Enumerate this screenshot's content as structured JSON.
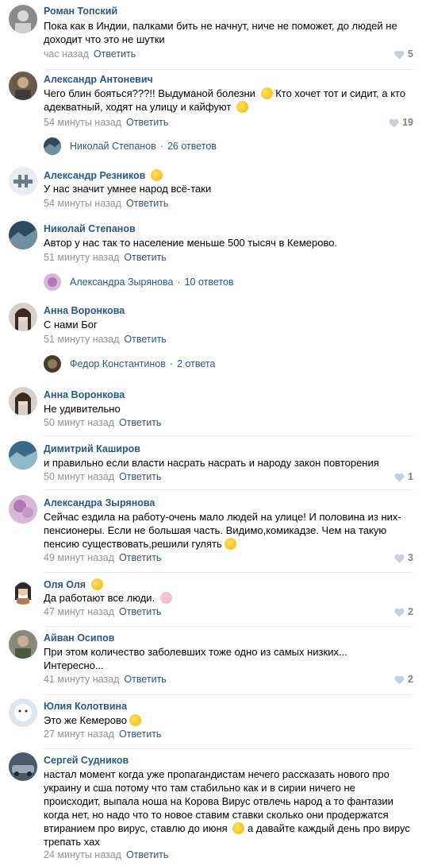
{
  "comments": [
    {
      "author": "Роман Топский",
      "text": "Пока как в Индии, палками бить не начнут, ниче не поможет, до людей не доходит что это не шутки",
      "time": "час назад",
      "reply": "Ответить",
      "likes": "5"
    },
    {
      "author": "Александр Антоневич",
      "text": "Чего блин бояться???!! Выдуманой болезни",
      "text2": "Кто хочет тот и сидит, а кто адекватный, ходят на улицу и кайфуют",
      "time": "54 минуты назад",
      "reply": "Ответить",
      "likes": "19"
    },
    {
      "author": "Александр Резников",
      "text": "У нас значит умнее народ всё-таки",
      "time": "54 минуты назад",
      "reply": "Ответить",
      "likes": ""
    },
    {
      "author": "Николай Степанов",
      "text": "Автор у нас так то население меньше 500 тысяч в Кемерово.",
      "time": "51 минуту назад",
      "reply": "Ответить",
      "likes": ""
    },
    {
      "author": "Анна Воронкова",
      "text": "С нами Бог",
      "time": "51 минуту назад",
      "reply": "Ответить",
      "likes": ""
    },
    {
      "author": "Анна Воронкова",
      "text": "Не удивительно",
      "time": "50 минут назад",
      "reply": "Ответить",
      "likes": ""
    },
    {
      "author": "Димитрий Каширов",
      "text": "и правильно если власти насрать насрать и народу закон повторения",
      "time": "50 минут назад",
      "reply": "Ответить",
      "likes": "1"
    },
    {
      "author": "Александра Зырянова",
      "text": "Сейчас ездила на работу-очень мало людей на улице! И половина из них-пенсионеры. Если не большая часть. Видимо,комикадзе. Чем на такую пенсию существовать,решили гулять",
      "time": "49 минут назад",
      "reply": "Ответить",
      "likes": "3"
    },
    {
      "author": "Оля Оля",
      "text": "Да работают все люди.",
      "time": "47 минут назад",
      "reply": "Ответить",
      "likes": "2"
    },
    {
      "author": "Айван Осипов",
      "text": "При этом количество заболевших тоже одно из самых низких... Интересно...",
      "time": "41 минуту назад",
      "reply": "Ответить",
      "likes": "2"
    },
    {
      "author": "Юлия Колотвина",
      "text": "Это же Кемерово",
      "time": "27 минут назад",
      "reply": "Ответить",
      "likes": ""
    },
    {
      "author": "Сергей Судников",
      "text": "настал момент когда уже пропагандистам нечего рассказать нового про украину и сша потому что там стабильно как и в сирии ничего не происходит, выпала ноша на Корова Вирус отвлечь народ а то фантазии когда нет, но надо что то новое ставим ставки сколько они продержатся втиранием про вирус, ставлю до июня",
      "text2": "а давайте каждый день про вирус трепать хах",
      "time": "24 минуты назад",
      "reply": "Ответить",
      "likes": ""
    }
  ],
  "threads": [
    {
      "name": "Николай Степанов",
      "count": "26 ответов"
    },
    {
      "name": "Александра Зырянова",
      "count": "10 ответов"
    },
    {
      "name": "Федор Константинов",
      "count": "2 ответа"
    }
  ],
  "colors": {
    "link": "#2a5885",
    "muted": "#939393",
    "likes": "#828282"
  }
}
